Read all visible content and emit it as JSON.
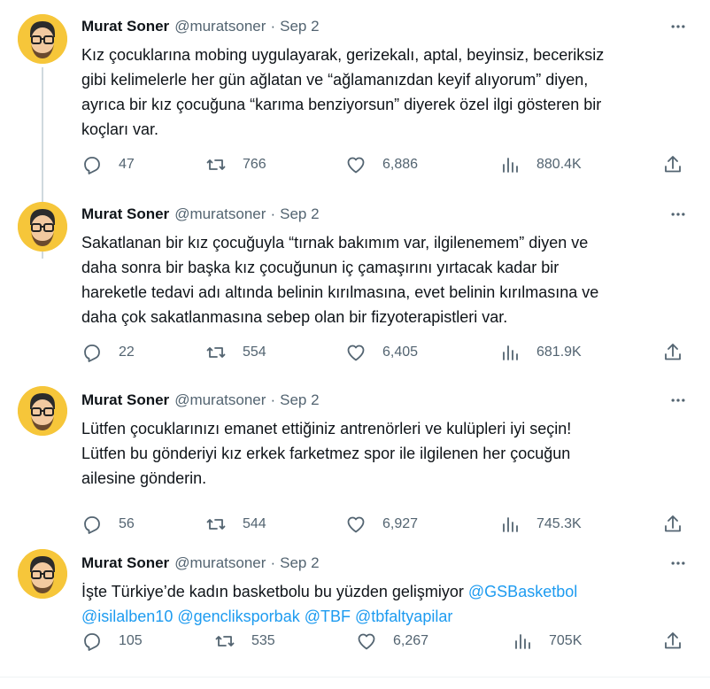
{
  "colors": {
    "accent": "#1d9bf0",
    "secondary_text": "#536471",
    "avatar_bg": "#f6c63a"
  },
  "icons": [
    "more-icon",
    "reply-icon",
    "retweet-icon",
    "like-icon",
    "views-icon",
    "share-icon"
  ],
  "tweets": [
    {
      "author": "Murat Soner",
      "handle": "@muratsoner",
      "separator": "·",
      "date": "Sep 2",
      "lines": [
        "Kız çocuklarına mobing uygulayarak, gerizekalı, aptal, beyinsiz, beceriksiz",
        "gibi kelimelerle her gün ağlatan ve “ağlamanızdan keyif alıyorum” diyen,",
        "ayrıca bir kız çocuğuna “karıma benziyorsun” diyerek özel ilgi gösteren bir",
        "koçları var."
      ],
      "replies": "47",
      "retweets": "766",
      "likes": "6,886",
      "views": "880.4K"
    },
    {
      "author": "Murat Soner",
      "handle": "@muratsoner",
      "separator": "·",
      "date": "Sep 2",
      "lines": [
        "Sakatlanan bir kız çocuğuyla “tırnak bakımım var, ilgilenemem” diyen ve",
        "daha sonra bir başka kız çocuğunun iç çamaşırını yırtacak kadar bir",
        "hareketle tedavi adı altında belinin kırılmasına, evet belinin kırılmasına ve",
        "daha çok sakatlanmasına sebep olan bir fizyoterapistleri var."
      ],
      "replies": "22",
      "retweets": "554",
      "likes": "6,405",
      "views": "681.9K"
    },
    {
      "author": "Murat Soner",
      "handle": "@muratsoner",
      "separator": "·",
      "date": "Sep 2",
      "lines": [
        "Lütfen çocuklarınızı emanet ettiğiniz antrenörleri ve kulüpleri iyi seçin!",
        "Lütfen bu gönderiyi kız erkek farketmez spor ile ilgilenen her çocuğun",
        "ailesine gönderin."
      ],
      "replies": "56",
      "retweets": "544",
      "likes": "6,927",
      "views": "745.3K"
    },
    {
      "author": "Murat Soner",
      "handle": "@muratsoner",
      "separator": "·",
      "date": "Sep 2",
      "line1_text": "İşte Türkiye’de kadın basketbolu bu yüzden gelişmiyor ",
      "line1_mention": "@GSBasketbol",
      "line2_mentions": [
        "@isilalben10",
        "@gencliksporbak",
        "@TBF",
        "@tbfaltyapilar"
      ],
      "replies": "105",
      "retweets": "535",
      "likes": "6,267",
      "views": "705K"
    }
  ]
}
